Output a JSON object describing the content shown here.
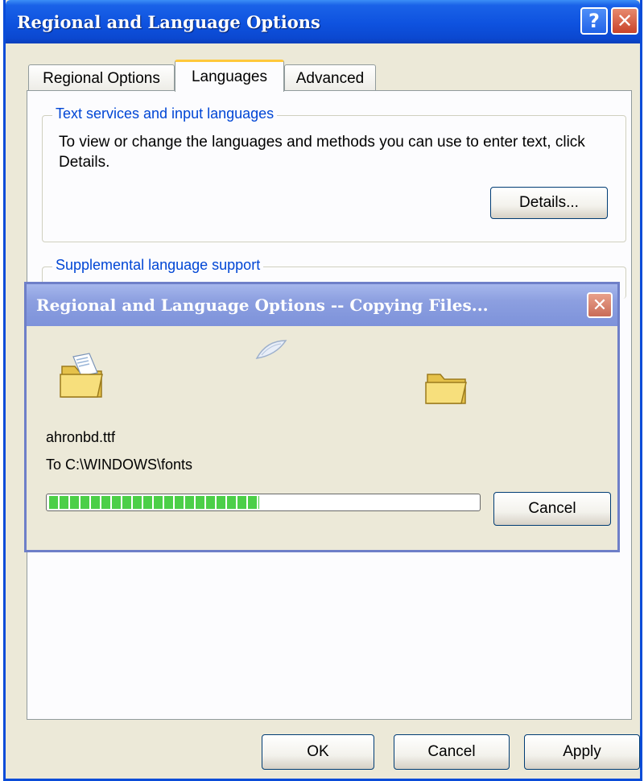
{
  "window": {
    "title": "Regional and Language Options",
    "help_label": "?",
    "close_label": "✕"
  },
  "tabs": [
    {
      "label": "Regional Options",
      "active": false
    },
    {
      "label": "Languages",
      "active": true
    },
    {
      "label": "Advanced",
      "active": false
    }
  ],
  "text_services": {
    "legend": "Text services and input languages",
    "description": "To view or change the languages and methods you can use to enter text, click Details.",
    "details_button": "Details..."
  },
  "supplemental": {
    "legend": "Supplemental language support"
  },
  "copy_dialog": {
    "title": "Regional and Language Options -- Copying Files...",
    "close_label": "✕",
    "file_name": "ahronbd.ttf",
    "destination": "To C:\\WINDOWS\\fonts",
    "progress_percent": 49,
    "cancel_button": "Cancel",
    "icons": {
      "source": "folder-open-icon",
      "flying": "file-flying-icon",
      "target": "folder-icon"
    }
  },
  "footer": {
    "ok": "OK",
    "cancel": "Cancel",
    "apply": "Apply"
  },
  "colors": {
    "titlebar_active": "#0b4ee0",
    "titlebar_inactive": "#8c9fe0",
    "legend_text": "#0046d5",
    "progress_fill": "#4ccf48",
    "dialog_bg": "#ece9d8"
  }
}
